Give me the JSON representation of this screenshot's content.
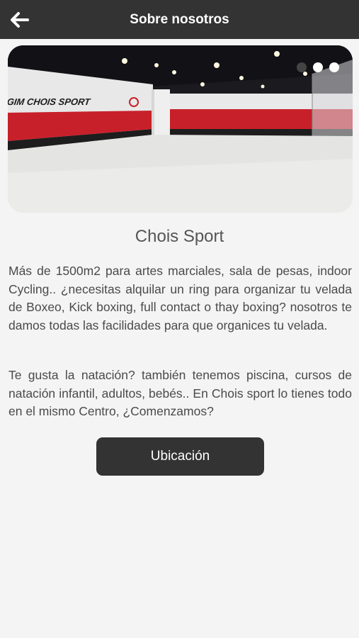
{
  "header": {
    "back_icon": "arrow-left-icon",
    "title": "Sobre nosotros"
  },
  "carousel": {
    "slide_count": 3,
    "active_index": 1,
    "image_sign_text": "GIM CHOIS SPORT"
  },
  "content": {
    "title": "Chois Sport",
    "paragraph1": "Más de 1500m2 para artes marciales, sala de pesas, indoor Cycling.. ¿necesitas alquilar un ring para organizar tu velada de Boxeo, Kick boxing, full contact o thay boxing? nosotros te damos todas las facilidades para que organices tu velada.",
    "paragraph2": "Te gusta la natación? también tenemos piscina, cursos de natación infantil, adultos, bebés.. En Chois sport lo tienes todo en el mismo Centro, ¿Comenzamos?"
  },
  "actions": {
    "location_button": "Ubicación"
  },
  "colors": {
    "header_bg": "#333333",
    "page_bg": "#f4f4f4",
    "button_bg": "#333333",
    "wall_red": "#c8202a"
  }
}
